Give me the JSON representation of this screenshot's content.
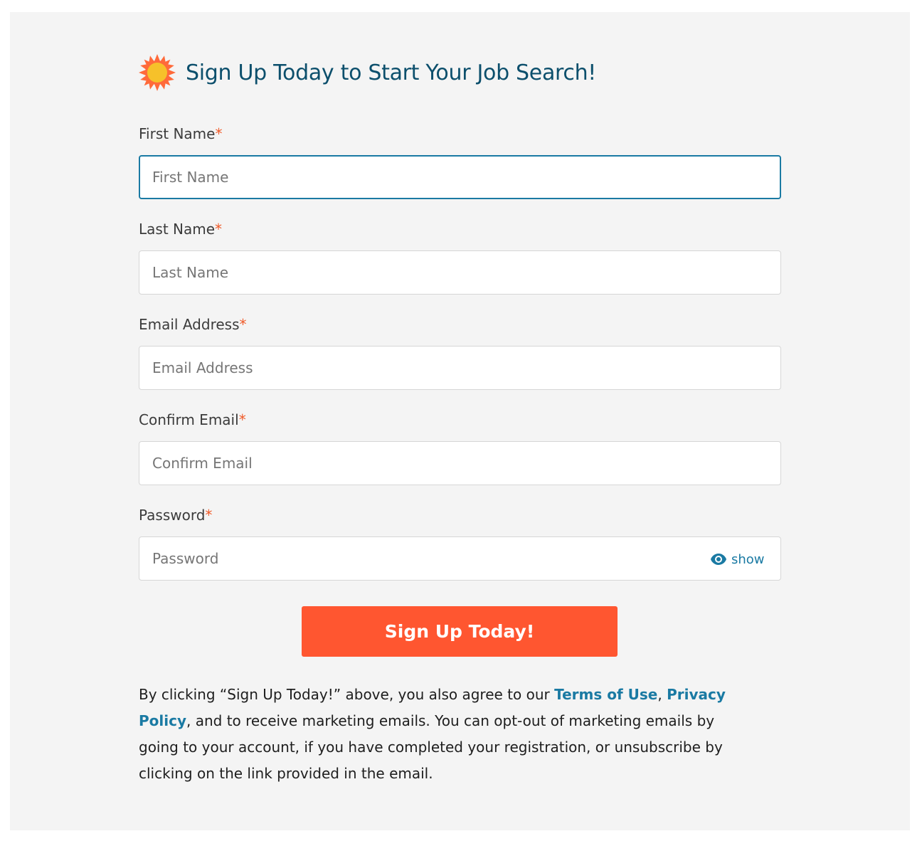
{
  "header": {
    "title": "Sign Up Today to Start Your Job Search!",
    "logo_icon": "sun-icon"
  },
  "colors": {
    "title": "#0c4f6c",
    "required_marker": "#f05a28",
    "link": "#1a7aa3",
    "button": "#ff5630",
    "panel_background": "#f4f4f4"
  },
  "form": {
    "fields": [
      {
        "label": "First Name",
        "required_mark": "*",
        "placeholder": "First Name",
        "value": "",
        "focused": true
      },
      {
        "label": "Last Name",
        "required_mark": "*",
        "placeholder": "Last Name",
        "value": ""
      },
      {
        "label": "Email Address",
        "required_mark": "*",
        "placeholder": "Email Address",
        "value": ""
      },
      {
        "label": "Confirm Email",
        "required_mark": "*",
        "placeholder": "Confirm Email",
        "value": ""
      },
      {
        "label": "Password",
        "required_mark": "*",
        "placeholder": "Password",
        "value": ""
      }
    ],
    "show_password_label": "show",
    "show_password_icon": "eye-icon",
    "submit_label": "Sign Up Today!"
  },
  "legal": {
    "text_before": "By clicking “Sign Up Today!” above, you also agree to our ",
    "terms_link": "Terms of Use",
    "separator": ", ",
    "privacy_link": "Privacy Policy",
    "text_after": ", and to receive marketing emails. You can opt-out of marketing emails by going to your account, if you have completed your registration, or unsubscribe by clicking on the link provided in the email."
  }
}
